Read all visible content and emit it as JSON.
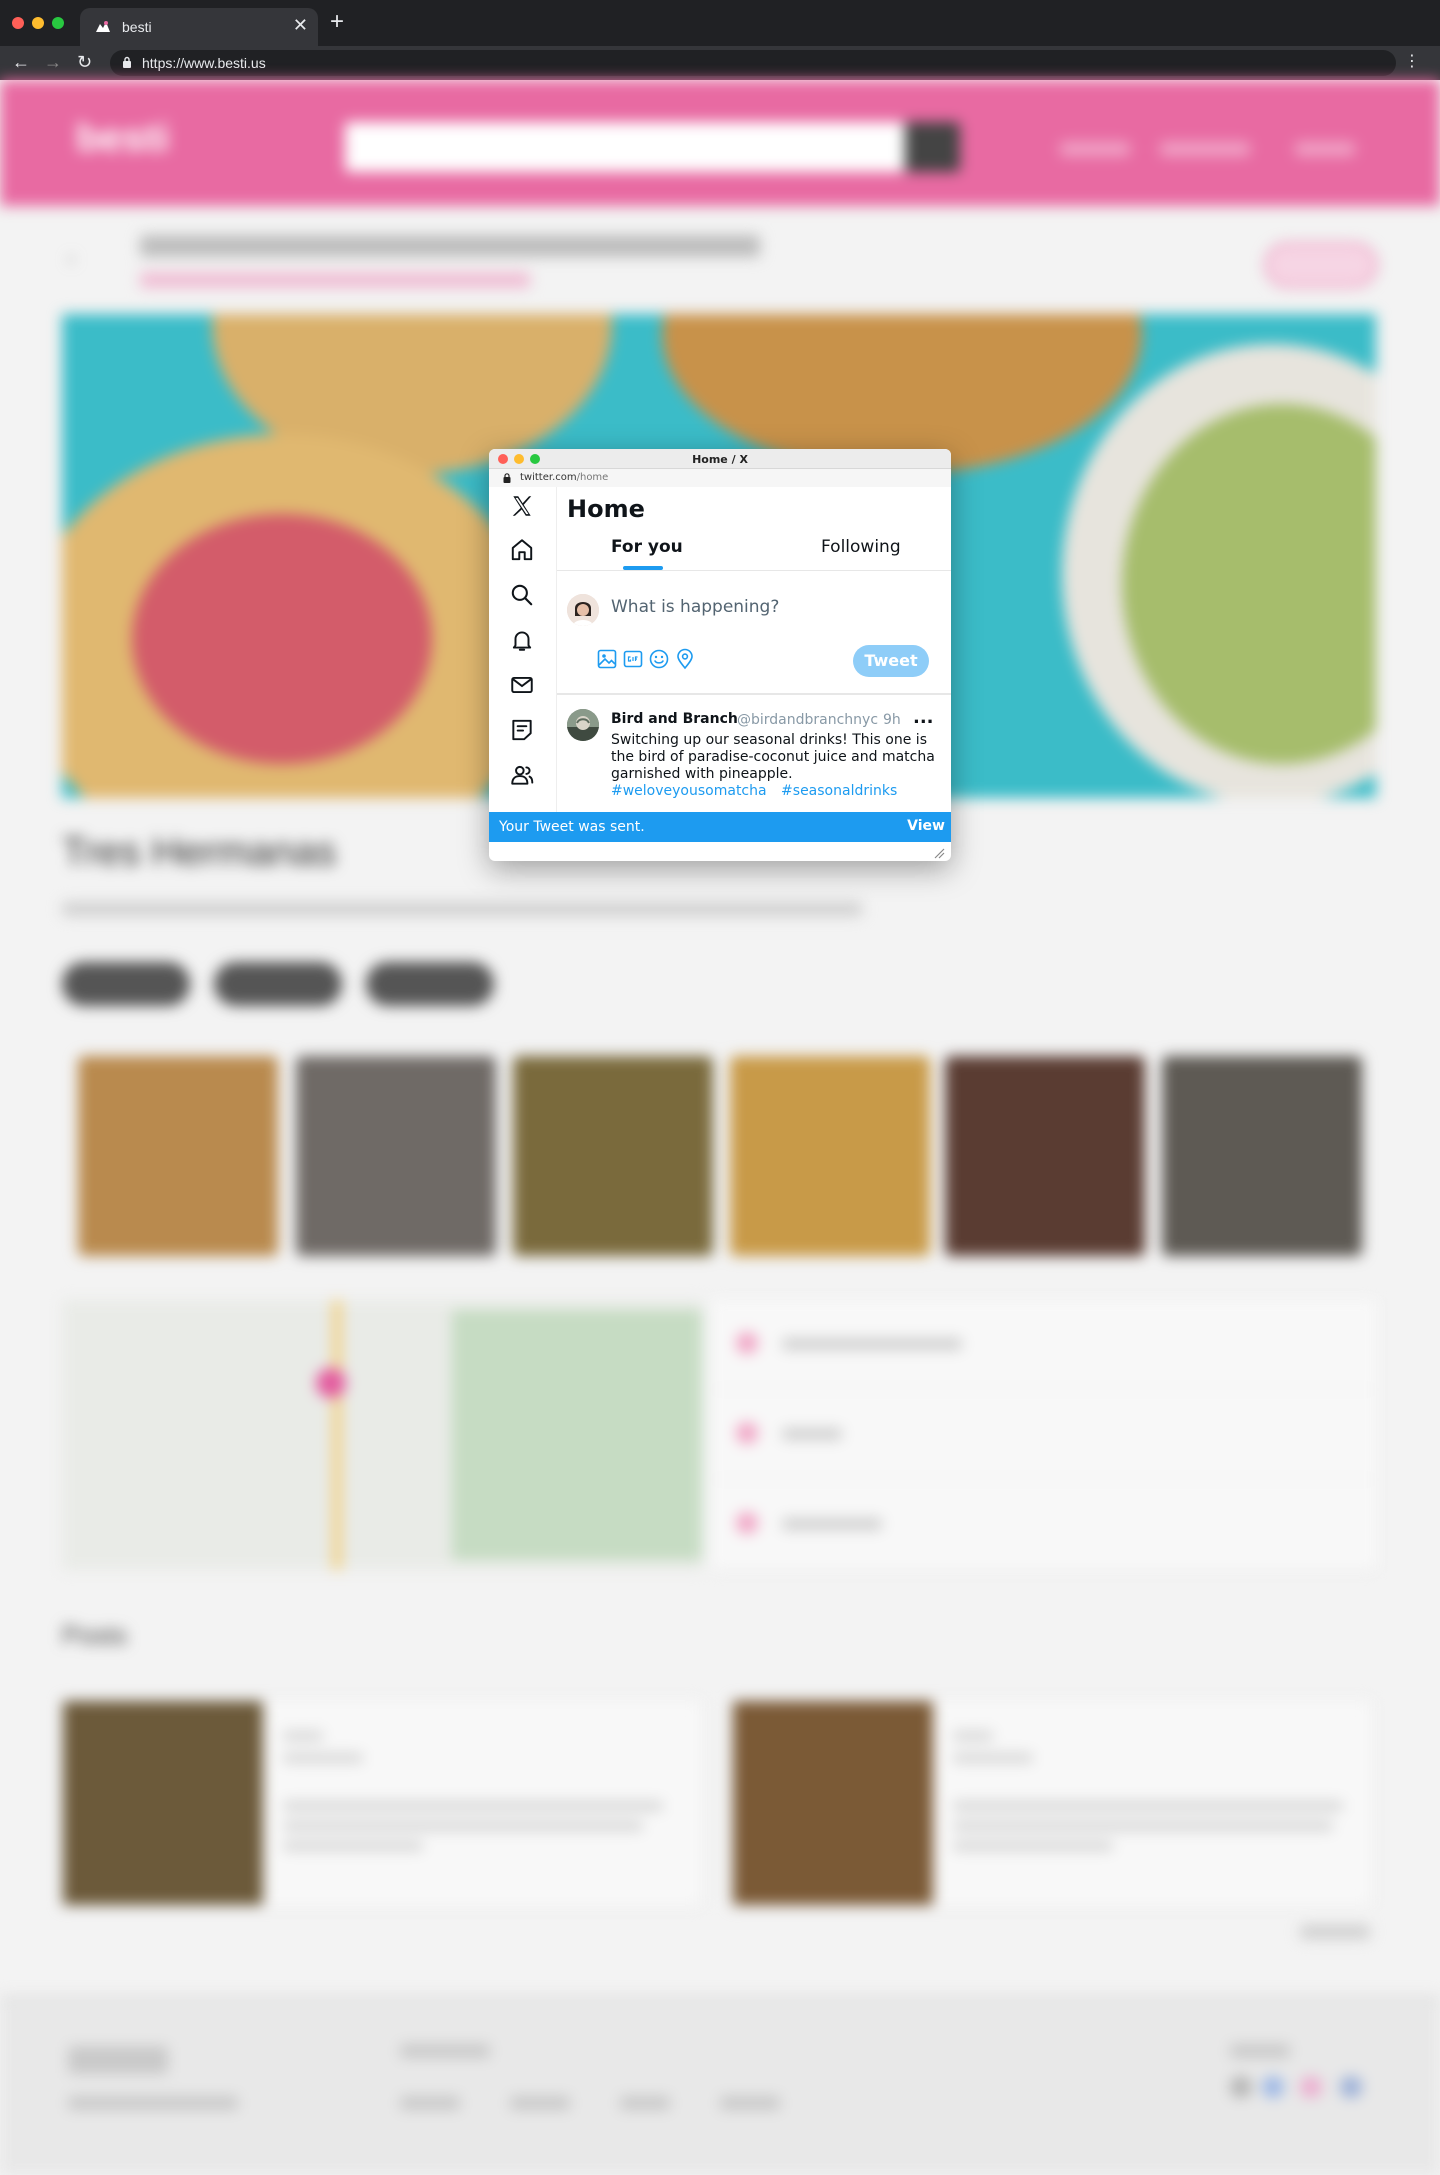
{
  "browser": {
    "tab_title": "besti",
    "tab_close": "✕",
    "new_tab": "+",
    "url": "https://www.besti.us",
    "back": "←",
    "forward": "→",
    "reload": "↻",
    "menu": "⋮"
  },
  "site": {
    "logo_text": "besti",
    "page_title": "Tres Hermanas",
    "posts_heading": "Posts",
    "colors": {
      "header_pink": "#e86aa2",
      "twitter_blue": "#1d9bf0"
    }
  },
  "twitter_window": {
    "window_title": "Home / X",
    "url_host": "twitter.com",
    "url_path": "/home",
    "sidebar_icons": [
      "x-logo-icon",
      "home-icon",
      "search-icon",
      "bell-icon",
      "mail-icon",
      "lists-icon",
      "communities-icon"
    ],
    "header": "Home",
    "tabs": [
      {
        "label": "For you",
        "active": true
      },
      {
        "label": "Following",
        "active": false
      }
    ],
    "compose": {
      "placeholder": "What is happening?",
      "tools": [
        "image-icon",
        "gif-icon",
        "emoji-icon",
        "location-icon"
      ],
      "tweet_button": "Tweet"
    },
    "post": {
      "author": "Bird and Branch",
      "handle": "@birdandbranchnyc",
      "time": "9h",
      "more": "...",
      "text": "Switching up our seasonal drinks! This one is the bird of paradise-coconut juice and matcha garnished with pineapple.",
      "hashtags": [
        "#weloveyousomatcha",
        "#seasonaldrinks"
      ]
    },
    "toast": {
      "message": "Your Tweet was sent.",
      "action": "View"
    }
  }
}
